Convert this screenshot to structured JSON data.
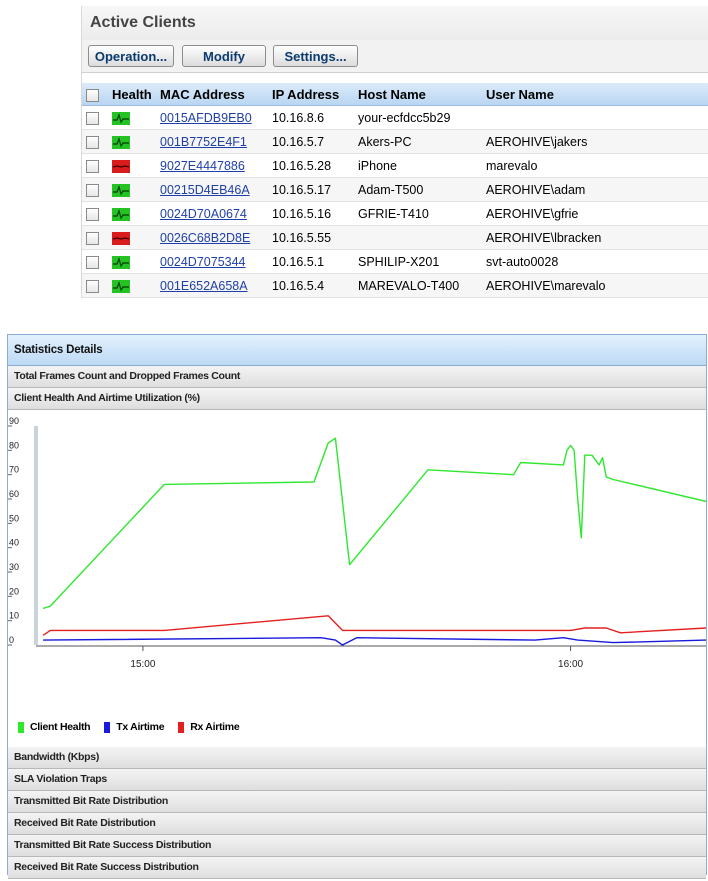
{
  "clients": {
    "title": "Active Clients",
    "buttons": {
      "operation": "Operation...",
      "modify": "Modify",
      "settings": "Settings..."
    },
    "columns": {
      "health": "Health",
      "mac": "MAC Address",
      "ip": "IP Address",
      "host": "Host Name",
      "user": "User Name"
    },
    "rows": [
      {
        "health": "good",
        "mac": "0015AFDB9EB0",
        "ip": "10.16.8.6",
        "host": "your-ecfdcc5b29",
        "user": ""
      },
      {
        "health": "good",
        "mac": "001B7752E4F1",
        "ip": "10.16.5.7",
        "host": "Akers-PC",
        "user": "AEROHIVE\\jakers"
      },
      {
        "health": "bad",
        "mac": "9027E4447886",
        "ip": "10.16.5.28",
        "host": "iPhone",
        "user": "marevalo"
      },
      {
        "health": "good",
        "mac": "00215D4EB46A",
        "ip": "10.16.5.17",
        "host": "Adam-T500",
        "user": "AEROHIVE\\adam"
      },
      {
        "health": "good",
        "mac": "0024D70A0674",
        "ip": "10.16.5.16",
        "host": "GFRIE-T410",
        "user": "AEROHIVE\\gfrie"
      },
      {
        "health": "bad",
        "mac": "0026C68B2D8E",
        "ip": "10.16.5.55",
        "host": "",
        "user": "AEROHIVE\\lbracken"
      },
      {
        "health": "good",
        "mac": "0024D7075344",
        "ip": "10.16.5.1",
        "host": "SPHILIP-X201",
        "user": "svt-auto0028"
      },
      {
        "health": "good",
        "mac": "001E652A658A",
        "ip": "10.16.5.4",
        "host": "MAREVALO-T400",
        "user": "AEROHIVE\\marevalo"
      }
    ],
    "colors": {
      "good": "#22c322",
      "bad": "#d91b1b"
    }
  },
  "stats": {
    "title": "Statistics Details",
    "sections_top": [
      "Total Frames Count and Dropped Frames Count",
      "Client Health And Airtime Utilization (%)"
    ],
    "sections_bottom": [
      "Bandwidth (Kbps)",
      "SLA Violation Traps",
      "Transmitted Bit Rate Distribution",
      "Received Bit Rate Distribution",
      "Transmitted Bit Rate Success Distribution",
      "Received Bit Rate Success Distribution"
    ]
  },
  "chart_data": {
    "type": "line",
    "ylim": [
      0,
      90
    ],
    "yticks": [
      0,
      10,
      20,
      30,
      40,
      50,
      60,
      70,
      80,
      90
    ],
    "xlim": [
      "14:45",
      "16:19"
    ],
    "xticks": [
      "15:00",
      "16:00"
    ],
    "grid": false,
    "legend": "bottom-left",
    "series": [
      {
        "name": "Client Health",
        "color": "#2ee82e",
        "x": [
          "14:46",
          "14:47",
          "15:03",
          "15:24",
          "15:26",
          "15:27",
          "15:29",
          "15:40",
          "15:52",
          "15:53",
          "15:59",
          "15:59.5",
          "16:00",
          "16:00.5",
          "16:01",
          "16:01.5",
          "16:02",
          "16:03",
          "16:04",
          "16:04.5",
          "16:05",
          "16:06",
          "16:19"
        ],
        "y": [
          15,
          16,
          66,
          67,
          83,
          85,
          33,
          72,
          70,
          75,
          74,
          80,
          82,
          80,
          60,
          44,
          78,
          78,
          74,
          77,
          69,
          68,
          59
        ]
      },
      {
        "name": "Tx Airtime",
        "color": "#1a1add",
        "x": [
          "14:46",
          "15:25",
          "15:27",
          "15:28",
          "15:30",
          "15:55",
          "15:59",
          "16:01",
          "16:06",
          "16:19"
        ],
        "y": [
          2,
          3,
          2,
          0,
          3,
          2,
          3,
          2,
          1,
          2
        ]
      },
      {
        "name": "Rx Airtime",
        "color": "#e32020",
        "x": [
          "14:46",
          "14:47",
          "15:03",
          "15:26",
          "15:28",
          "16:00",
          "16:02",
          "16:05",
          "16:07",
          "16:19"
        ],
        "y": [
          4,
          6,
          6,
          12,
          6,
          6,
          7,
          7,
          5,
          7
        ]
      }
    ]
  }
}
